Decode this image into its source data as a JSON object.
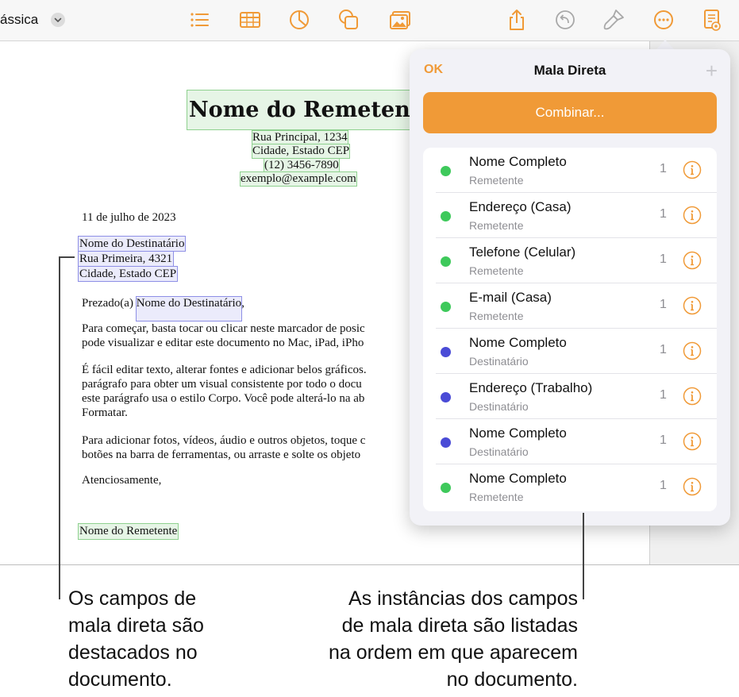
{
  "toolbar": {
    "view_label": "ássica",
    "icons": [
      "list-icon",
      "table-icon",
      "chart-icon",
      "shape-icon",
      "media-icon",
      "share-icon",
      "undo-icon",
      "format-brush-icon",
      "more-icon",
      "document-icon"
    ]
  },
  "document": {
    "sender_name": "Nome do Remetente",
    "address_line1": "Rua Principal, 1234",
    "address_line2": "Cidade, Estado CEP",
    "phone": "(12) 3456-7890",
    "email": "exemplo@example.com",
    "date": "11 de julho de 2023",
    "recipient_name": "Nome do Destinatário",
    "recipient_street": "Rua Primeira, 4321",
    "recipient_city": "Cidade, Estado CEP",
    "greeting_prefix": "Prezado(a)",
    "greeting_field": "Nome do Destinatário",
    "greeting_suffix": ",",
    "para1_line1": "Para começar, basta tocar ou clicar neste marcador de posic",
    "para1_line2": "pode visualizar e editar este documento no Mac, iPad, iPho",
    "para2_line1": "É fácil editar texto, alterar fontes e adicionar belos gráficos.",
    "para2_line2": "parágrafo para obter um visual consistente por todo o docu",
    "para2_line3": "este parágrafo usa o estilo Corpo. Você pode alterá-lo na ab",
    "para2_line4": "Formatar.",
    "para3_line1": "Para adicionar fotos, vídeos, áudio e outros objetos, toque c",
    "para3_line2": "botões na barra de ferramentas, ou arraste e solte os objeto",
    "closing": "Atenciosamente,",
    "signature": "Nome do Remetente"
  },
  "popover": {
    "ok_label": "OK",
    "title": "Mala Direta",
    "add_label": "+",
    "combine_label": "Combinar...",
    "rows": [
      {
        "title": "Nome Completo",
        "subtitle": "Remetente",
        "count": "1",
        "color": "#3ec95b"
      },
      {
        "title": "Endereço (Casa)",
        "subtitle": "Remetente",
        "count": "1",
        "color": "#3ec95b"
      },
      {
        "title": "Telefone (Celular)",
        "subtitle": "Remetente",
        "count": "1",
        "color": "#3ec95b"
      },
      {
        "title": "E-mail (Casa)",
        "subtitle": "Remetente",
        "count": "1",
        "color": "#3ec95b"
      },
      {
        "title": "Nome Completo",
        "subtitle": "Destinatário",
        "count": "1",
        "color": "#4a4bd6"
      },
      {
        "title": "Endereço (Trabalho)",
        "subtitle": "Destinatário",
        "count": "1",
        "color": "#4a4bd6"
      },
      {
        "title": "Nome Completo",
        "subtitle": "Destinatário",
        "count": "1",
        "color": "#4a4bd6"
      },
      {
        "title": "Nome Completo",
        "subtitle": "Remetente",
        "count": "1",
        "color": "#3ec95b"
      }
    ]
  },
  "captions": {
    "left": [
      "Os campos de",
      "mala direta são",
      "destacados no",
      "documento."
    ],
    "right": [
      "As instâncias dos campos",
      "de mala direta são listadas",
      "na ordem em que aparecem",
      "no documento."
    ]
  },
  "colors": {
    "accent": "#f09a37",
    "sender_field": "#3ec95b",
    "recipient_field": "#4a4bd6"
  }
}
